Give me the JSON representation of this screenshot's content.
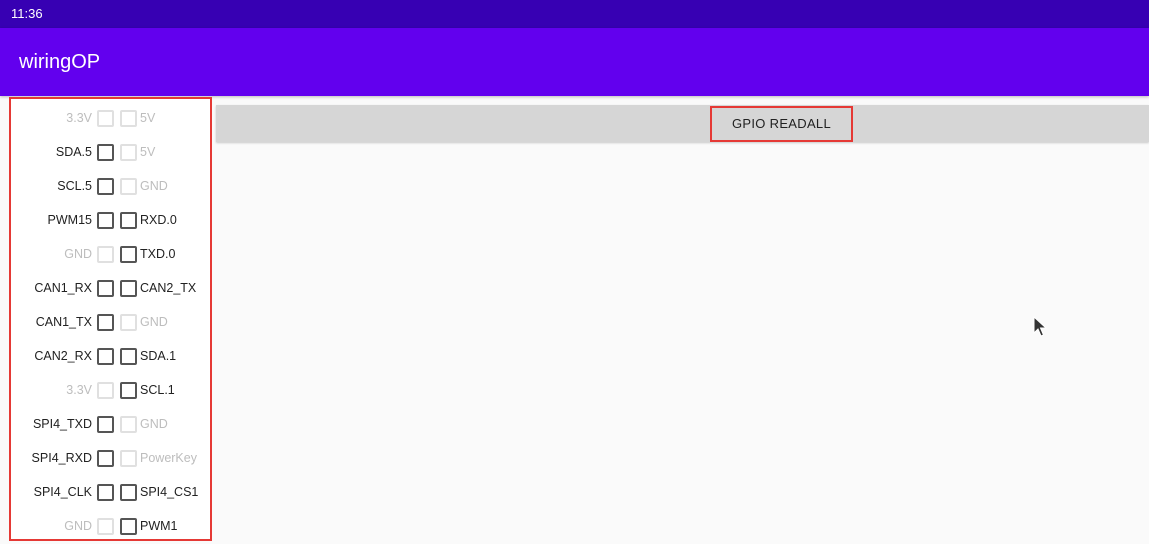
{
  "status_bar": {
    "time": "11:36"
  },
  "app_bar": {
    "title": "wiringOP"
  },
  "readall_button": {
    "label": "GPIO READALL"
  },
  "pins": [
    {
      "left": "3.3V",
      "left_enabled": false,
      "right": "5V",
      "right_enabled": false
    },
    {
      "left": "SDA.5",
      "left_enabled": true,
      "right": "5V",
      "right_enabled": false
    },
    {
      "left": "SCL.5",
      "left_enabled": true,
      "right": "GND",
      "right_enabled": false
    },
    {
      "left": "PWM15",
      "left_enabled": true,
      "right": "RXD.0",
      "right_enabled": true
    },
    {
      "left": "GND",
      "left_enabled": false,
      "right": "TXD.0",
      "right_enabled": true
    },
    {
      "left": "CAN1_RX",
      "left_enabled": true,
      "right": "CAN2_TX",
      "right_enabled": true
    },
    {
      "left": "CAN1_TX",
      "left_enabled": true,
      "right": "GND",
      "right_enabled": false
    },
    {
      "left": "CAN2_RX",
      "left_enabled": true,
      "right": "SDA.1",
      "right_enabled": true
    },
    {
      "left": "3.3V",
      "left_enabled": false,
      "right": "SCL.1",
      "right_enabled": true
    },
    {
      "left": "SPI4_TXD",
      "left_enabled": true,
      "right": "GND",
      "right_enabled": false
    },
    {
      "left": "SPI4_RXD",
      "left_enabled": true,
      "right": "PowerKey",
      "right_enabled": false
    },
    {
      "left": "SPI4_CLK",
      "left_enabled": true,
      "right": "SPI4_CS1",
      "right_enabled": true
    },
    {
      "left": "GND",
      "left_enabled": false,
      "right": "PWM1",
      "right_enabled": true
    }
  ],
  "colors": {
    "status_bar": "#3700b3",
    "app_bar": "#6200ee",
    "highlight_border": "#e53935",
    "disabled_text": "#bdbdbd"
  },
  "icons": {
    "pointer": "mouse-cursor-icon"
  }
}
